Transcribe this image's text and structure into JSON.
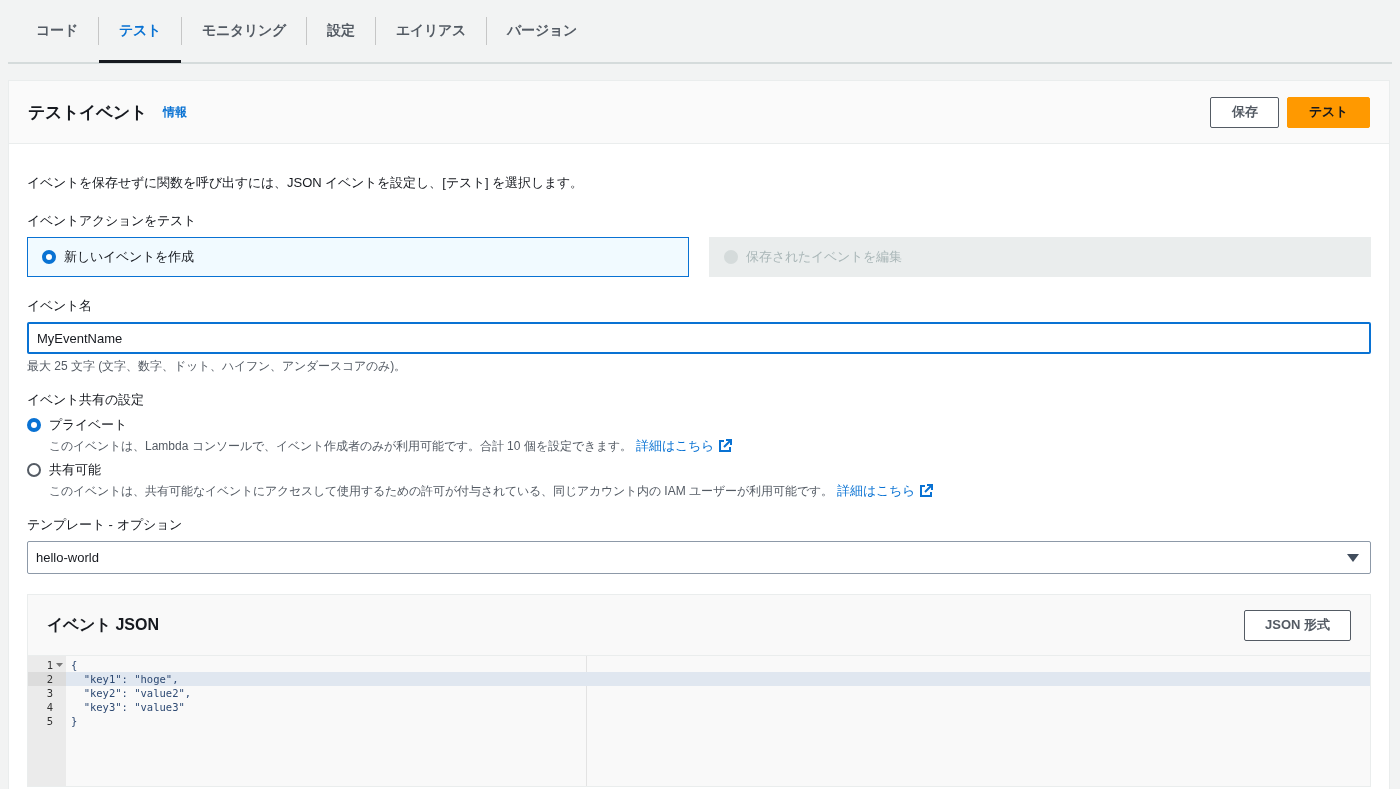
{
  "tabs": [
    {
      "label": "コード",
      "selected": false
    },
    {
      "label": "テスト",
      "selected": true
    },
    {
      "label": "モニタリング",
      "selected": false
    },
    {
      "label": "設定",
      "selected": false
    },
    {
      "label": "エイリアス",
      "selected": false
    },
    {
      "label": "バージョン",
      "selected": false
    }
  ],
  "panel": {
    "title": "テストイベント",
    "info_link": "情報",
    "buttons": [
      {
        "label": "保存",
        "kind": "normal"
      },
      {
        "label": "テスト",
        "kind": "primary"
      }
    ],
    "description": "イベントを保存せずに関数を呼び出すには、JSON イベントを設定し、[テスト] を選択します。",
    "action": {
      "label": "イベントアクションをテスト",
      "options": [
        {
          "label": "新しいイベントを作成",
          "selected": true,
          "disabled": false
        },
        {
          "label": "保存されたイベントを編集",
          "selected": false,
          "disabled": true
        }
      ]
    },
    "event_name": {
      "label": "イベント名",
      "value": "MyEventName",
      "hint": "最大 25 文字 (文字、数字、ドット、ハイフン、アンダースコアのみ)。"
    },
    "sharing": {
      "label": "イベント共有の設定",
      "options": [
        {
          "label": "プライベート",
          "selected": true,
          "description": "このイベントは、Lambda コンソールで、イベント作成者のみが利用可能です。合計 10 個を設定できます。",
          "link": "詳細はこちら"
        },
        {
          "label": "共有可能",
          "selected": false,
          "description": "このイベントは、共有可能なイベントにアクセスして使用するための許可が付与されている、同じアカウント内の IAM ユーザーが利用可能です。",
          "link": "詳細はこちら"
        }
      ]
    },
    "template": {
      "label": "テンプレート - オプション",
      "value": "hello-world"
    },
    "event_json": {
      "title": "イベント JSON",
      "format_button": "JSON 形式",
      "lines": [
        {
          "number": "1",
          "text": "{",
          "active": false,
          "foldable": true
        },
        {
          "number": "2",
          "text": "  \"key1\": \"hoge\",",
          "active": true,
          "foldable": false
        },
        {
          "number": "3",
          "text": "  \"key2\": \"value2\",",
          "active": false,
          "foldable": false
        },
        {
          "number": "4",
          "text": "  \"key3\": \"value3\"",
          "active": false,
          "foldable": false
        },
        {
          "number": "5",
          "text": "}",
          "active": false,
          "foldable": false
        }
      ]
    }
  }
}
